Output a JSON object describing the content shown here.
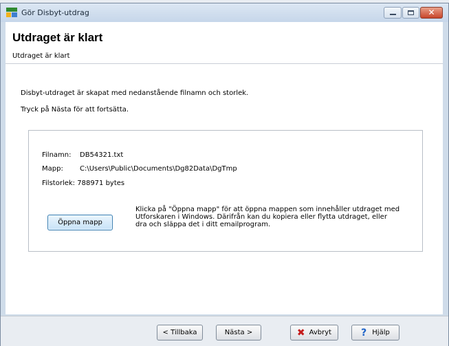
{
  "window": {
    "title": "Gör Disbyt-utdrag",
    "icon": "app-icon",
    "close_glyph": "✕"
  },
  "header": {
    "title": "Utdraget är klart",
    "subtitle": "Utdraget är klart"
  },
  "content": {
    "line1": "Disbyt-utdraget är skapat med nedanstående filnamn och storlek.",
    "line2": "Tryck på Nästa för att fortsätta.",
    "file": {
      "name_label": "Filnamn:",
      "name_value": "DB54321.txt",
      "folder_label": "Mapp:",
      "folder_value": "C:\\Users\\Public\\Documents\\Dg82Data\\DgTmp",
      "size_label": "Filstorlek:",
      "size_value": "788971 bytes"
    },
    "open_button": "Öppna mapp",
    "help_text": "Klicka på \"Öppna mapp\" för att öppna mappen som innehåller utdraget med Utforskaren i Windows. Därifrån kan du kopiera eller flytta utdraget, eller dra och släppa det i ditt emailprogram."
  },
  "footer": {
    "back": "< Tillbaka",
    "next": "Nästa >",
    "cancel": "Avbryt",
    "help": "Hjälp",
    "cancel_icon": "✖",
    "help_icon": "?"
  },
  "colors": {
    "accent": "#3c7fb1",
    "cancel_icon": "#c41b1b",
    "help_icon": "#1e63c8"
  }
}
